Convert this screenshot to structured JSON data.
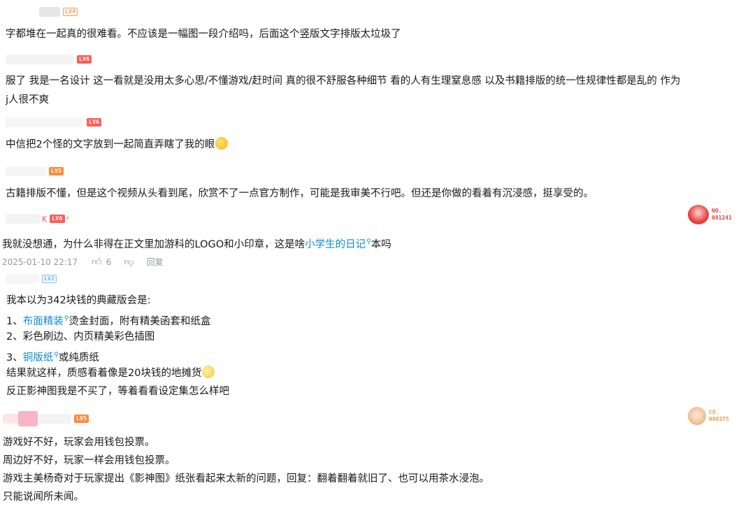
{
  "comments": [
    {
      "level": "LV4",
      "lines": [
        "字都堆在一起真的很难看。不应该是一幅图一段介绍吗，后面这个竖版文字排版太垃圾了"
      ]
    },
    {
      "level": "LV6",
      "lines": [
        "服了 我是一名设计 这一看就是没用太多心思/不懂游戏/赶时间 真的很不舒服各种细节 看的人有生理窒息感 以及书籍排版的统一性规律性都是乱的 作为",
        "j人很不爽"
      ]
    },
    {
      "level": "LV6",
      "lines": [
        "中信把2个怪的文字放到一起简直弄瞎了我的眼"
      ]
    },
    {
      "level": "LV5",
      "lines": [
        "古籍排版不懂，但是这个视频从头看到尾，欣赏不了一点官方制作，可能是我审美不行吧。但还是你做的看着有沉浸感，挺享受的。"
      ]
    },
    {
      "username_fragment": "K",
      "level": "LV6",
      "line_before_link": "我就没想通，为什么非得在正文里加游科的LOGO和小印章，这是啥",
      "link": "小学生的日记",
      "line_after_link": "本吗",
      "timestamp": "2025-01-10 22:17",
      "likes": "6",
      "reply_label": "回复",
      "badge_number_label": "NO.",
      "badge_number": "001241"
    },
    {
      "level": "LV2",
      "l1": "我本以为342块钱的典藏版会是:",
      "l2_prefix": "1、",
      "l2_link": "布面精装",
      "l2_suffix": "烫金封面，附有精美函套和纸盒",
      "l3": "2、彩色刷边、内页精美彩色插图",
      "l4_prefix": "3、",
      "l4_link": "铜版纸",
      "l4_suffix": "或纯质纸",
      "l5": "结果就这样，质感看着像是20块钱的地摊货",
      "l6": "反正影神图我是不买了，等着看看设定集怎么样吧"
    },
    {
      "level": "LV5",
      "lines": [
        "游戏好不好，玩家会用钱包投票。",
        "周边好不好，玩家一样会用钱包投票。",
        "游戏主美杨奇对于玩家提出《影神图》纸张看起来太新的问题，回复：翻着翻着就旧了、也可以用茶水浸泡。",
        "只能说闻所未闻。"
      ],
      "badge_number_label": "CO.",
      "badge_number": "000375"
    }
  ],
  "icons": {
    "search": "search-icon",
    "like": "thumbs-up-icon",
    "dislike": "thumbs-down-icon",
    "emoji_laugh": "laughing-emoji-icon",
    "emoji_smile": "smile-emoji-icon"
  },
  "colors": {
    "text": "#18191c",
    "link": "#0f8ccf",
    "meta": "#9499a0",
    "lv6": "#ff5b5b",
    "lv5": "#ff8a3c",
    "lv4": "#f2a35f",
    "lv2": "#6fb3e8",
    "badge_red": "#e8413c",
    "badge_orange": "#e8a04c"
  }
}
